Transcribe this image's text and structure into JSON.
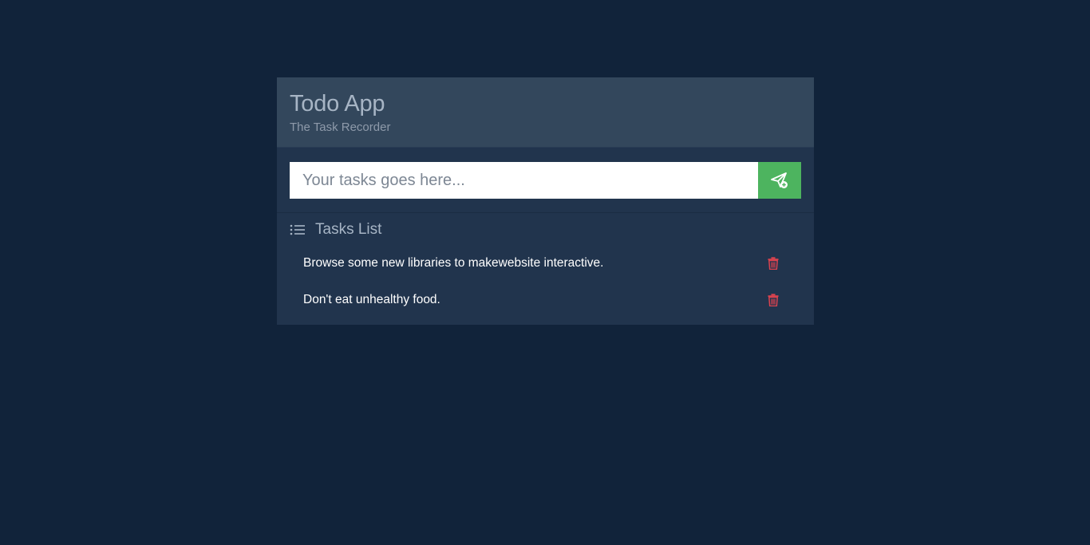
{
  "app": {
    "title": "Todo App",
    "subtitle": "The Task Recorder"
  },
  "form": {
    "placeholder": "Your tasks goes here...",
    "value": "",
    "submit_icon": "send-add-icon",
    "submit_color": "#4db45f"
  },
  "tasks_list": {
    "heading": "Tasks List",
    "heading_icon": "list-icon",
    "items": [
      {
        "text": "Browse some new libraries to makewebsite interactive.",
        "delete_icon": "trash-icon"
      },
      {
        "text": "Don't eat unhealthy food.",
        "delete_icon": "trash-icon"
      }
    ]
  },
  "colors": {
    "background": "#11233a",
    "header": "#33475c",
    "panel": "#21344d",
    "delete": "#d9434f"
  }
}
